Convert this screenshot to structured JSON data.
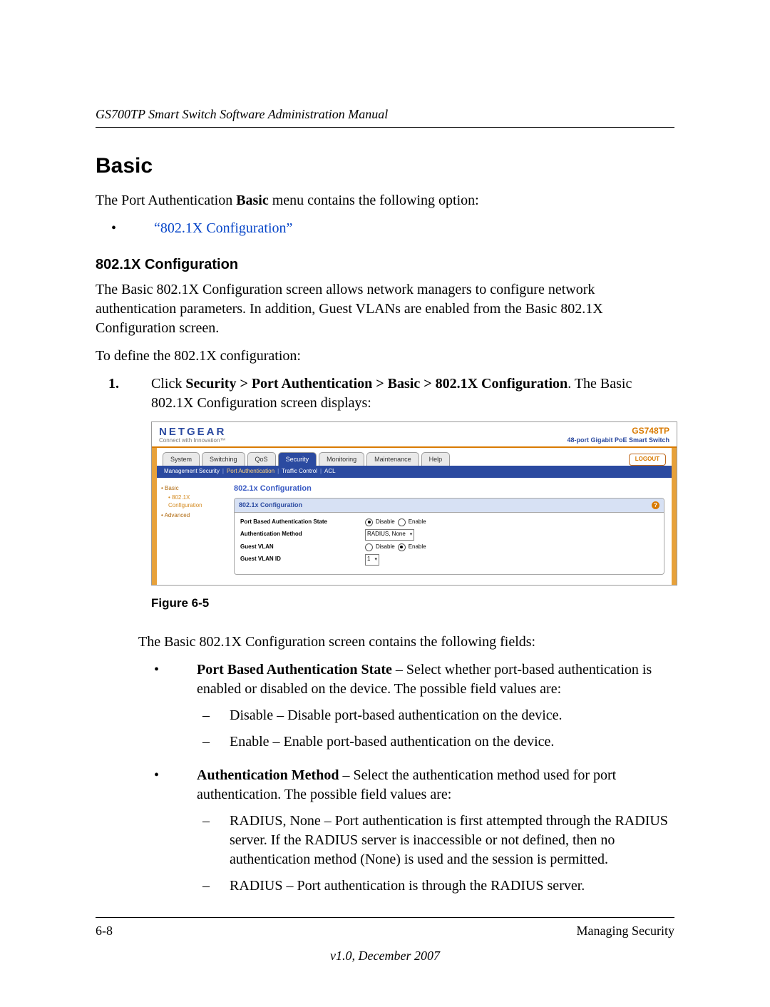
{
  "header": {
    "running": "GS700TP Smart Switch Software Administration Manual"
  },
  "h1": "Basic",
  "intro": {
    "pre": "The Port Authentication ",
    "bold": "Basic",
    "post": " menu contains the following option:"
  },
  "bullet_link": "“802.1X Configuration”",
  "h2": "802.1X Configuration",
  "p_desc": "The Basic 802.1X Configuration screen allows network managers to configure network authentication parameters. In addition, Guest VLANs are enabled from the Basic 802.1X Configuration screen.",
  "p_define": "To define the 802.1X configuration:",
  "step1": {
    "pre": "Click ",
    "path": "Security > Port Authentication > Basic > 802.1X Configuration",
    "post": ". The Basic 802.1X Configuration screen displays:"
  },
  "figure_caption": "Figure 6-5",
  "p_fields_intro": "The Basic 802.1X Configuration screen contains the following fields:",
  "field1": {
    "name": "Port Based Authentication State",
    "rest": " – Select whether port-based authentication is enabled or disabled on the device. The possible field values are:",
    "opt_a": "Disable – Disable port-based authentication on the device.",
    "opt_b": "Enable – Enable port-based authentication on the device."
  },
  "field2": {
    "name": "Authentication Method",
    "rest": " – Select the authentication method used for port authentication. The possible field values are:",
    "opt_a": "RADIUS, None – Port authentication is first attempted through the RADIUS server. If the RADIUS server is inaccessible or not defined, then no authentication method (None) is used and the session is permitted.",
    "opt_b": "RADIUS – Port authentication is through the RADIUS server."
  },
  "footer": {
    "left": "6-8",
    "right": "Managing Security",
    "center": "v1.0, December 2007"
  },
  "shot": {
    "brand": "NETGEAR",
    "tagline": "Connect with Innovation™",
    "model": "GS748TP",
    "model_desc": "48-port Gigabit PoE Smart Switch",
    "logout": "LOGOUT",
    "tabs": [
      "System",
      "Switching",
      "QoS",
      "Security",
      "Monitoring",
      "Maintenance",
      "Help"
    ],
    "active_tab": "Security",
    "subnav": {
      "items": [
        "Management Security",
        "Port Authentication",
        "Traffic Control",
        "ACL"
      ],
      "active": "Port Authentication"
    },
    "side": {
      "basic": "Basic",
      "cfg": "802.1X Configuration",
      "adv": "Advanced"
    },
    "panel": {
      "page_title": "802.1x Configuration",
      "head": "802.1x Configuration",
      "rows": {
        "pbas": "Port Based Authentication State",
        "auth": "Authentication Method",
        "gvlan": "Guest VLAN",
        "gvid": "Guest VLAN ID"
      },
      "opts": {
        "disable": "Disable",
        "enable": "Enable",
        "auth_sel": "RADIUS, None",
        "gvid_sel": "1"
      }
    }
  }
}
